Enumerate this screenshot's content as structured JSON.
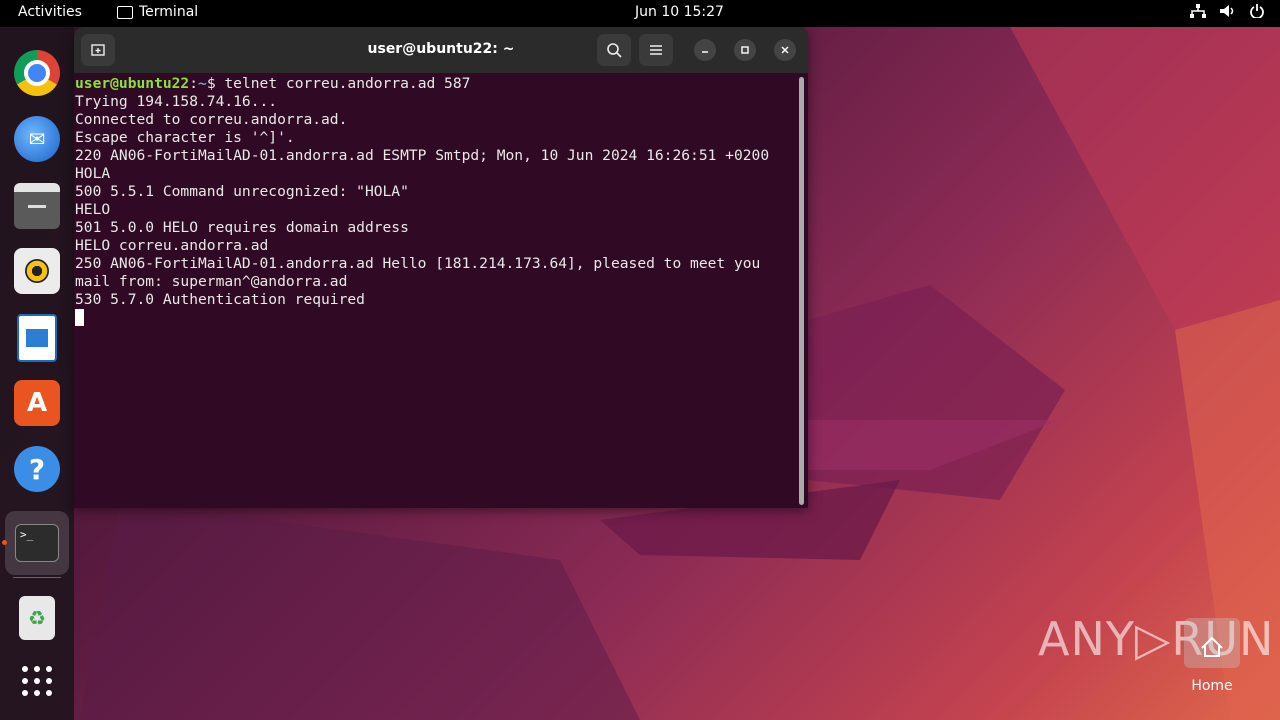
{
  "topbar": {
    "activities": "Activities",
    "app_name": "Terminal",
    "clock": "Jun 10  15:27"
  },
  "dock": {
    "items": [
      {
        "name": "Google Chrome",
        "icon": "chrome-icon"
      },
      {
        "name": "Thunderbird",
        "icon": "thunderbird-icon"
      },
      {
        "name": "Files",
        "icon": "files-icon"
      },
      {
        "name": "Rhythmbox",
        "icon": "rhythmbox-icon"
      },
      {
        "name": "LibreOffice Writer",
        "icon": "writer-icon"
      },
      {
        "name": "Ubuntu Software",
        "icon": "app-center-icon"
      },
      {
        "name": "Help",
        "icon": "help-icon"
      },
      {
        "name": "Terminal",
        "icon": "terminal-icon"
      },
      {
        "name": "Trash",
        "icon": "trash-icon"
      },
      {
        "name": "Show Applications",
        "icon": "app-grid-icon"
      }
    ],
    "help_glyph": "?",
    "appcenter_glyph": "A",
    "terminal_glyph": ">_",
    "trash_glyph": "♻"
  },
  "terminal": {
    "title": "user@ubuntu22: ~",
    "prompt_user": "user@ubuntu22",
    "prompt_sep": ":",
    "prompt_path": "~",
    "prompt_command": "$ telnet correu.andorra.ad 587",
    "output_lines": [
      "Trying 194.158.74.16...",
      "Connected to correu.andorra.ad.",
      "Escape character is '^]'.",
      "220 AN06-FortiMailAD-01.andorra.ad ESMTP Smtpd; Mon, 10 Jun 2024 16:26:51 +0200",
      "HOLA",
      "500 5.5.1 Command unrecognized: \"HOLA\"",
      "HELO",
      "501 5.0.0 HELO requires domain address",
      "HELO correu.andorra.ad",
      "250 AN06-FortiMailAD-01.andorra.ad Hello [181.214.173.64], pleased to meet you",
      "mail from: superman^@andorra.ad",
      "530 5.7.0 Authentication required"
    ]
  },
  "desktop": {
    "home_label": "Home",
    "watermark": "ANY▷RUN"
  },
  "colors": {
    "terminal_bg": "#300a24",
    "prompt_user": "#8ae234",
    "prompt_path": "#729fcf",
    "accent": "#e95420"
  }
}
